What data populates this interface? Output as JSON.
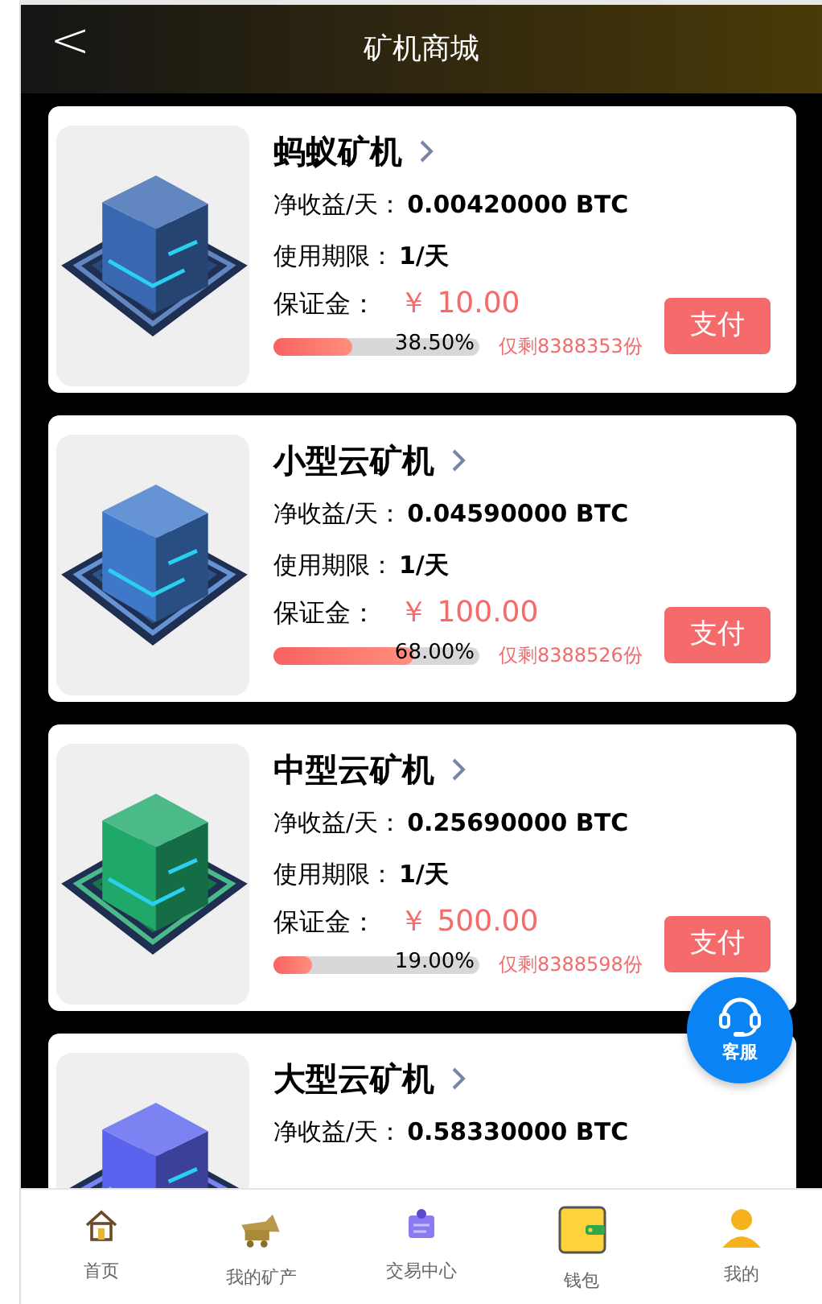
{
  "header": {
    "back": "<",
    "title": "矿机商城"
  },
  "miners": [
    {
      "name": "蚂蚁矿机",
      "color": "#3a68b0",
      "income_label": "净收益/天：",
      "income": "0.00420000 BTC",
      "period_label": "使用期限：",
      "period": "1/天",
      "deposit_label": "保证金：",
      "price": "￥ 10.00",
      "level": 0.385,
      "percent": "38.50%",
      "remaining": "仅剩8388353份",
      "button": "支付"
    },
    {
      "name": "小型云矿机",
      "color": "#3f78c8",
      "income_label": "净收益/天：",
      "income": "0.04590000 BTC",
      "period_label": "使用期限：",
      "period": "1/天",
      "deposit_label": "保证金：",
      "price": "￥ 100.00",
      "level": 0.68,
      "percent": "68.00%",
      "remaining": "仅剩8388526份",
      "button": "支付"
    },
    {
      "name": "中型云矿机",
      "color": "#1fa86a",
      "income_label": "净收益/天：",
      "income": "0.25690000 BTC",
      "period_label": "使用期限：",
      "period": "1/天",
      "deposit_label": "保证金：",
      "price": "￥ 500.00",
      "level": 0.19,
      "percent": "19.00%",
      "remaining": "仅剩8388598份",
      "button": "支付"
    },
    {
      "name": "大型云矿机",
      "color": "#5a63ee",
      "income_label": "净收益/天：",
      "income": "0.58330000 BTC"
    }
  ],
  "service": {
    "label": "客服"
  },
  "tabbar": [
    {
      "kind": "home",
      "label": "首页"
    },
    {
      "kind": "mine",
      "label": "我的矿产"
    },
    {
      "kind": "trade",
      "label": "交易中心"
    },
    {
      "kind": "wallet",
      "label": "钱包"
    },
    {
      "kind": "user",
      "label": "我的"
    }
  ]
}
